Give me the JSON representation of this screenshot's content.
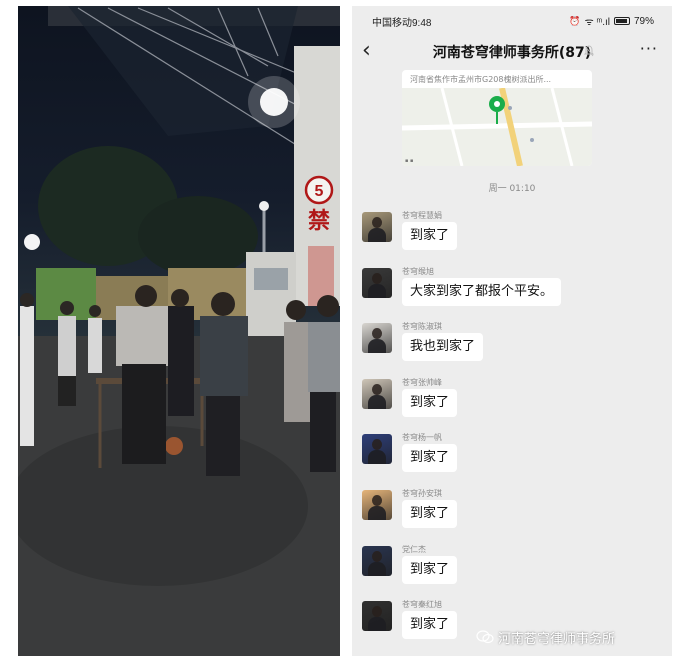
{
  "status_bar": {
    "carrier": "中国移动",
    "time": "9:48",
    "signal_text": "ᯤ ᵐ.ıl",
    "battery": "79%"
  },
  "chat": {
    "title": "河南苍穹律师事务所(87)",
    "more": "···",
    "back": "‹"
  },
  "map": {
    "address": "河南省焦作市孟州市G208槐树派出所..."
  },
  "timestamp": "周一 01:10",
  "messages": [
    {
      "sender": "苍穹程慧娟",
      "text": "到家了",
      "avatar_color": "#a8997a"
    },
    {
      "sender": "苍穹缑旭",
      "text": "大家到家了都报个平安。",
      "avatar_color": "#3a3a3a"
    },
    {
      "sender": "苍穹陈淑琪",
      "text": "我也到家了",
      "avatar_color": "#d9d6d1"
    },
    {
      "sender": "苍穹张帅峰",
      "text": "到家了",
      "avatar_color": "#cfc6b8"
    },
    {
      "sender": "苍穹杨一帆",
      "text": "到家了",
      "avatar_color": "#2e3f7a"
    },
    {
      "sender": "苍穹孙安琪",
      "text": "到家了",
      "avatar_color": "#e6b57a"
    },
    {
      "sender": "党仁杰",
      "text": "到家了",
      "avatar_color": "#2a3550"
    },
    {
      "sender": "苍穹秦红旭",
      "text": "到家了",
      "avatar_color": "#303030"
    }
  ],
  "photo": {
    "sign_number": "5",
    "sign_text": "禁"
  },
  "watermark": {
    "text": "河南苍穹律师事务所"
  }
}
